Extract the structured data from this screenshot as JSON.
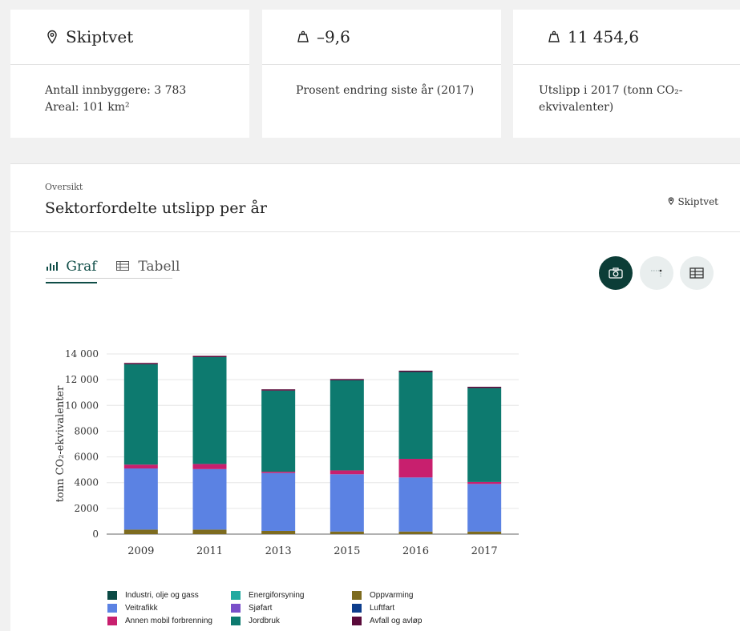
{
  "cards": [
    {
      "title": "Skiptvet",
      "lines": [
        "Antall innbyggere: 3 783",
        "Areal: 101 km²"
      ]
    },
    {
      "title": "–9,6",
      "lines": [
        "Prosent endring siste år (2017)"
      ]
    },
    {
      "title": "11 454,6",
      "lines": [
        "Utslipp i 2017 (tonn CO₂-",
        "ekvivalenter)"
      ]
    }
  ],
  "overview": {
    "tag": "Oversikt",
    "title": "Sektorfordelte utslipp per år",
    "location": "Skiptvet"
  },
  "tabs": {
    "graf": "Graf",
    "tabell": "Tabell"
  },
  "colors": {
    "accent": "#0c3d37"
  },
  "icons": {
    "card1": "map-pin-icon",
    "card2": "weight-icon",
    "card3": "weight-icon",
    "camera": "camera-icon",
    "line": "line-chart-icon",
    "table": "table-icon"
  },
  "chart_data": {
    "type": "bar",
    "stacked": true,
    "categories": [
      "2009",
      "2011",
      "2013",
      "2015",
      "2016",
      "2017"
    ],
    "ylabel": "tonn CO₂-ekvivalenter",
    "ylim": [
      0,
      14000
    ],
    "yticks": [
      "0",
      "2000",
      "4000",
      "6000",
      "8000",
      "10 000",
      "12 000",
      "14 000"
    ],
    "grid": true,
    "legend_position": "bottom",
    "series": [
      {
        "name": "Oppvarming",
        "color": "#7d6b1f",
        "values": [
          350,
          350,
          250,
          200,
          200,
          200
        ]
      },
      {
        "name": "Veitrafikk",
        "color": "#5b82e3",
        "values": [
          4750,
          4700,
          4500,
          4450,
          4200,
          3700
        ]
      },
      {
        "name": "Annen mobil forbrenning",
        "color": "#c81f6e",
        "values": [
          300,
          400,
          100,
          300,
          1450,
          150
        ]
      },
      {
        "name": "Jordbruk",
        "color": "#0d7a6f",
        "values": [
          7800,
          8300,
          6300,
          7000,
          6750,
          7300
        ]
      },
      {
        "name": "Industri, olje og gass",
        "color": "#0b4a45",
        "values": [
          0,
          0,
          0,
          0,
          0,
          0
        ]
      },
      {
        "name": "Energiforsyning",
        "color": "#22aaa0",
        "values": [
          0,
          0,
          0,
          0,
          0,
          0
        ]
      },
      {
        "name": "Sjøfart",
        "color": "#7a4fc9",
        "values": [
          0,
          0,
          0,
          0,
          0,
          0
        ]
      },
      {
        "name": "Luftfart",
        "color": "#0d3d8c",
        "values": [
          0,
          0,
          0,
          0,
          0,
          0
        ]
      },
      {
        "name": "Avfall og avløp",
        "color": "#5a0a3a",
        "values": [
          100,
          100,
          100,
          100,
          100,
          100
        ]
      }
    ],
    "legend_order": [
      "Industri, olje og gass",
      "Veitrafikk",
      "Annen mobil forbrenning",
      "Energiforsyning",
      "Sjøfart",
      "Jordbruk",
      "Oppvarming",
      "Luftfart",
      "Avfall og avløp"
    ]
  }
}
